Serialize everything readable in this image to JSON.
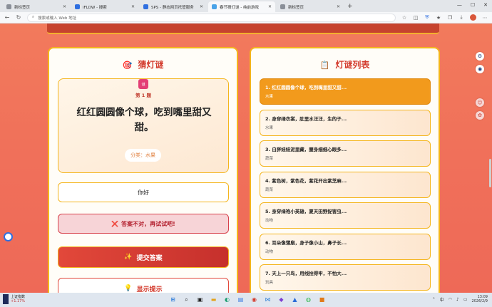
{
  "tabs": [
    {
      "title": "新标签页",
      "color": "#8a8f98"
    },
    {
      "title": "iFLOW - 搜索",
      "color": "#2f6fe0"
    },
    {
      "title": "SPS - 静态网页托管服务",
      "color": "#2f6fe0"
    },
    {
      "title": "春节猜灯谜 - 纯前游戏",
      "color": "#4aa3e8"
    },
    {
      "title": "新标签页",
      "color": "#8a8f98"
    }
  ],
  "address": {
    "placeholder": "搜索或输入 Web 地址"
  },
  "left_panel": {
    "title": "猜灯谜",
    "badge": "谜",
    "riddle_no": "第 1 题",
    "riddle_text": "红红圆圆像个球，吃到嘴里甜又甜。",
    "category": "分类：水果",
    "answer_value": "你好",
    "feedback": "答案不对，再试试吧!",
    "submit_label": "提交答案",
    "hint_label": "显示提示"
  },
  "right_panel": {
    "title": "灯谜列表",
    "items": [
      {
        "text": "1. 红红圆圆像个球，吃到嘴里甜又甜...",
        "category": "水果"
      },
      {
        "text": "2. 身穿绿衣裳，肚里水汪汪，生的子...",
        "category": "水果"
      },
      {
        "text": "3. 白胖娃娃泥里藏，腰身细细心眼多...",
        "category": "蔬菜"
      },
      {
        "text": "4. 紫色树，紫色花，紫花开出紫芝麻...",
        "category": "蔬菜"
      },
      {
        "text": "5. 身穿绿袍小英雄，夏天田野捉害虫...",
        "category": "动物"
      },
      {
        "text": "6. 耳朵像蒲扇，身子像小山，鼻子长...",
        "category": "动物"
      },
      {
        "text": "7. 天上一只鸟，用线拴得牢，不怕大...",
        "category": "玩具"
      }
    ]
  },
  "taskbar": {
    "stock_name": "上证指数",
    "stock_change": "+1.17%",
    "lang": "中",
    "time": "13:09",
    "date": "2026/2/9"
  }
}
